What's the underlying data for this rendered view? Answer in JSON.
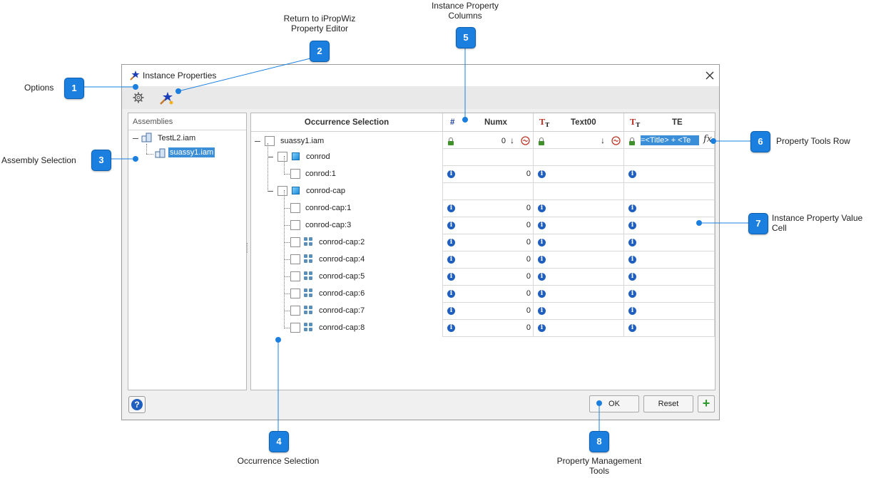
{
  "window": {
    "title": "Instance Properties"
  },
  "assemblies": {
    "header": "Assemblies",
    "root": "TestL2.iam",
    "child": "suassy1.iam"
  },
  "grid": {
    "columns": [
      {
        "type_icon": "#",
        "label": "Occurrence Selection"
      },
      {
        "type_icon": "#",
        "label": "Numx"
      },
      {
        "type_icon": "text-type-icon",
        "label": "Text00"
      },
      {
        "type_icon": "text-type-icon",
        "label": "TE"
      }
    ],
    "tools_row": {
      "label": "suassy1.iam",
      "numx_value": "0",
      "te_value": "=<Title> + <Te",
      "fx_label": "fx"
    },
    "rows": [
      {
        "label": "conrod",
        "kind": "part",
        "value": ""
      },
      {
        "label": "conrod:1",
        "kind": "occurrence",
        "value": "0"
      },
      {
        "label": "conrod-cap",
        "kind": "part",
        "value": ""
      },
      {
        "label": "conrod-cap:1",
        "kind": "occurrence",
        "value": "0"
      },
      {
        "label": "conrod-cap:3",
        "kind": "occurrence",
        "value": "0"
      },
      {
        "label": "conrod-cap:2",
        "kind": "pattern",
        "value": "0"
      },
      {
        "label": "conrod-cap:4",
        "kind": "pattern",
        "value": "0"
      },
      {
        "label": "conrod-cap:5",
        "kind": "pattern",
        "value": "0"
      },
      {
        "label": "conrod-cap:6",
        "kind": "pattern",
        "value": "0"
      },
      {
        "label": "conrod-cap:7",
        "kind": "pattern",
        "value": "0"
      },
      {
        "label": "conrod-cap:8",
        "kind": "pattern",
        "value": "0"
      }
    ]
  },
  "buttons": {
    "ok": "OK",
    "reset": "Reset",
    "add": "+",
    "help": "?"
  },
  "callouts": [
    {
      "n": "1",
      "label": "Options"
    },
    {
      "n": "2",
      "label": "Return to iPropWiz Property Editor"
    },
    {
      "n": "3",
      "label": "Assembly Selection"
    },
    {
      "n": "4",
      "label": "Occurrence Selection"
    },
    {
      "n": "5",
      "label": "Instance Property Columns"
    },
    {
      "n": "6",
      "label": "Property Tools Row"
    },
    {
      "n": "7",
      "label": "Instance Property Value Cell"
    },
    {
      "n": "8",
      "label": "Property Management Tools"
    }
  ],
  "colors": {
    "callout": "#1b7fdf",
    "selection": "#3b8fd8",
    "lock": "#3f8f2a",
    "info": "#1f5fbf"
  }
}
